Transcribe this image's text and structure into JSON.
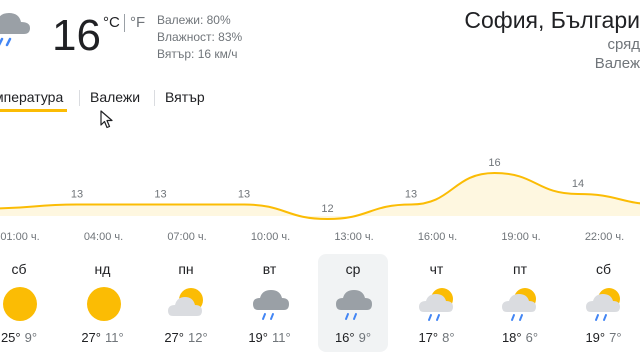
{
  "current": {
    "icon": "rain-cloud-icon",
    "temp": "16",
    "unit_c": "°C",
    "unit_f": "°F",
    "precip": "Валежи: 80%",
    "humidity": "Влажност: 83%",
    "wind": "Вятър: 16 км/ч"
  },
  "location": {
    "name": "София, Българи",
    "day": "сряд",
    "condition": "Валеж"
  },
  "tabs": [
    {
      "label": "мпература",
      "selected": true
    },
    {
      "label": "Валежи",
      "selected": false
    },
    {
      "label": "Вятър",
      "selected": false
    }
  ],
  "colors": {
    "accent": "#fbbc04",
    "fill": "#fef7e0"
  },
  "chart_data": {
    "type": "area",
    "x": [
      "01:00 ч.",
      "04:00 ч.",
      "07:00 ч.",
      "10:00 ч.",
      "13:00 ч.",
      "16:00 ч.",
      "19:00 ч.",
      "22:00 ч."
    ],
    "values": [
      13,
      13,
      13,
      12,
      13,
      16,
      14,
      13
    ],
    "labels": [
      "13",
      "13",
      "13",
      "12",
      "13",
      "16",
      "14",
      "13"
    ]
  },
  "days": [
    {
      "name": "сб",
      "icon": "sunny-icon",
      "hi": "25°",
      "lo": "9°",
      "selected": false
    },
    {
      "name": "нд",
      "icon": "sunny-icon",
      "hi": "27°",
      "lo": "11°",
      "selected": false
    },
    {
      "name": "пн",
      "icon": "partly-cloudy-icon",
      "hi": "27°",
      "lo": "12°",
      "selected": false
    },
    {
      "name": "вт",
      "icon": "rain-cloud-icon",
      "hi": "19°",
      "lo": "11°",
      "selected": false
    },
    {
      "name": "ср",
      "icon": "rain-cloud-icon",
      "hi": "16°",
      "lo": "9°",
      "selected": true
    },
    {
      "name": "чт",
      "icon": "sun-rain-cloud-icon",
      "hi": "17°",
      "lo": "8°",
      "selected": false
    },
    {
      "name": "пт",
      "icon": "sun-rain-cloud-icon",
      "hi": "18°",
      "lo": "6°",
      "selected": false
    },
    {
      "name": "сб",
      "icon": "sun-rain-cloud-icon",
      "hi": "19°",
      "lo": "7°",
      "selected": false
    }
  ]
}
